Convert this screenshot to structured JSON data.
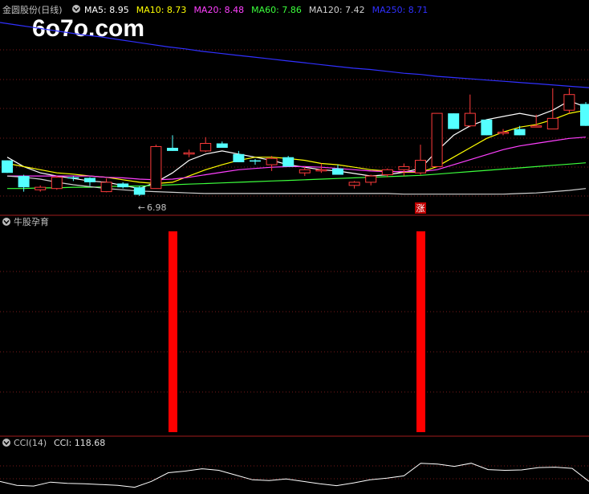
{
  "watermark": "6o7o.com",
  "colors": {
    "background": "#000000",
    "up": "#ff3b3b",
    "down": "#54ffff",
    "grid": "#7a1a1a",
    "divider": "#a01c1c",
    "signal_bar": "#ff0000",
    "cci_line": "#ffffff",
    "header_text": "#c0c0c0"
  },
  "chart_data": [
    {
      "type": "candlestick",
      "panel": "price",
      "title": "金圆股份(日线)",
      "ma_legend": [
        {
          "name": "MA5",
          "text": "MA5: 8.95",
          "color": "#ffffff"
        },
        {
          "name": "MA10",
          "text": "MA10: 8.73",
          "color": "#ffff00"
        },
        {
          "name": "MA20",
          "text": "MA20: 8.48",
          "color": "#ff40ff"
        },
        {
          "name": "MA60",
          "text": "MA60: 7.86",
          "color": "#3cff3c"
        },
        {
          "name": "MA120",
          "text": "MA120: 7.42",
          "color": "#d0d0d0"
        },
        {
          "name": "MA250",
          "text": "MA250: 8.71",
          "color": "#3030ff"
        }
      ],
      "ylim": [
        6.75,
        9.75
      ],
      "x": [
        0,
        1,
        2,
        3,
        4,
        5,
        6,
        7,
        8,
        9,
        10,
        11,
        12,
        13,
        14,
        15,
        16,
        17,
        18,
        19,
        20,
        21,
        22,
        23,
        24,
        25,
        26,
        27,
        28,
        29,
        30,
        31,
        32,
        33,
        34,
        35
      ],
      "ohlc": [
        [
          7.55,
          7.55,
          7.35,
          7.35
        ],
        [
          7.3,
          7.32,
          7.05,
          7.12
        ],
        [
          7.08,
          7.15,
          7.05,
          7.12
        ],
        [
          7.1,
          7.3,
          7.08,
          7.28
        ],
        [
          7.28,
          7.3,
          7.22,
          7.27
        ],
        [
          7.27,
          7.28,
          7.14,
          7.2
        ],
        [
          7.05,
          7.26,
          7.04,
          7.2
        ],
        [
          7.18,
          7.2,
          7.1,
          7.12
        ],
        [
          7.12,
          7.14,
          6.98,
          7.0
        ],
        [
          7.1,
          7.8,
          7.1,
          7.77
        ],
        [
          7.75,
          7.95,
          7.7,
          7.7
        ],
        [
          7.65,
          7.72,
          7.6,
          7.67
        ],
        [
          7.7,
          7.92,
          7.68,
          7.82
        ],
        [
          7.82,
          7.85,
          7.75,
          7.75
        ],
        [
          7.65,
          7.7,
          7.52,
          7.52
        ],
        [
          7.55,
          7.57,
          7.48,
          7.53
        ],
        [
          7.48,
          7.62,
          7.38,
          7.58
        ],
        [
          7.6,
          7.62,
          7.55,
          7.45
        ],
        [
          7.35,
          7.45,
          7.3,
          7.4
        ],
        [
          7.4,
          7.5,
          7.35,
          7.4
        ],
        [
          7.42,
          7.48,
          7.36,
          7.32
        ],
        [
          7.15,
          7.22,
          7.1,
          7.2
        ],
        [
          7.2,
          7.32,
          7.15,
          7.3
        ],
        [
          7.32,
          7.42,
          7.28,
          7.4
        ],
        [
          7.4,
          7.5,
          7.3,
          7.45
        ],
        [
          7.35,
          7.8,
          7.32,
          7.55
        ],
        [
          7.45,
          8.3,
          7.45,
          8.3
        ],
        [
          8.3,
          8.3,
          8.05,
          8.05
        ],
        [
          8.1,
          8.6,
          8.08,
          8.3
        ],
        [
          8.2,
          8.2,
          7.95,
          7.95
        ],
        [
          7.98,
          8.05,
          7.95,
          8.0
        ],
        [
          8.05,
          8.1,
          7.95,
          7.95
        ],
        [
          8.1,
          8.28,
          8.08,
          8.1
        ],
        [
          8.05,
          8.7,
          8.05,
          8.22
        ],
        [
          8.35,
          8.7,
          8.3,
          8.6
        ],
        [
          8.45,
          8.48,
          8.1,
          8.1
        ]
      ],
      "ma": {
        "MA5": [
          7.6,
          7.45,
          7.35,
          7.3,
          7.26,
          7.22,
          7.2,
          7.15,
          7.1,
          7.2,
          7.35,
          7.55,
          7.65,
          7.7,
          7.65,
          7.6,
          7.55,
          7.48,
          7.44,
          7.4,
          7.38,
          7.34,
          7.3,
          7.32,
          7.36,
          7.42,
          7.7,
          7.95,
          8.1,
          8.2,
          8.25,
          8.3,
          8.25,
          8.35,
          8.5,
          8.4
        ],
        "MA10": [
          7.5,
          7.45,
          7.4,
          7.35,
          7.33,
          7.3,
          7.28,
          7.24,
          7.2,
          7.18,
          7.2,
          7.3,
          7.4,
          7.48,
          7.55,
          7.6,
          7.6,
          7.58,
          7.55,
          7.5,
          7.48,
          7.44,
          7.4,
          7.38,
          7.36,
          7.36,
          7.45,
          7.6,
          7.75,
          7.9,
          8.0,
          8.08,
          8.12,
          8.2,
          8.3,
          8.35
        ],
        "MA20": [
          7.3,
          7.3,
          7.3,
          7.3,
          7.3,
          7.3,
          7.28,
          7.27,
          7.25,
          7.24,
          7.25,
          7.28,
          7.32,
          7.36,
          7.4,
          7.42,
          7.44,
          7.45,
          7.45,
          7.44,
          7.42,
          7.4,
          7.38,
          7.37,
          7.37,
          7.37,
          7.4,
          7.48,
          7.56,
          7.64,
          7.72,
          7.78,
          7.82,
          7.86,
          7.9,
          7.92
        ],
        "MA60": [
          7.1,
          7.1,
          7.11,
          7.11,
          7.12,
          7.12,
          7.13,
          7.14,
          7.14,
          7.15,
          7.16,
          7.17,
          7.18,
          7.19,
          7.2,
          7.21,
          7.22,
          7.23,
          7.24,
          7.25,
          7.26,
          7.27,
          7.28,
          7.29,
          7.3,
          7.31,
          7.33,
          7.35,
          7.37,
          7.39,
          7.41,
          7.43,
          7.45,
          7.47,
          7.49,
          7.51
        ],
        "MA120": [
          7.3,
          7.28,
          7.25,
          7.2,
          7.16,
          7.13,
          7.1,
          7.08,
          7.06,
          7.05,
          7.04,
          7.03,
          7.02,
          7.02,
          7.02,
          7.02,
          7.02,
          7.02,
          7.02,
          7.02,
          7.02,
          7.02,
          7.02,
          7.02,
          7.01,
          7.01,
          7.01,
          7.01,
          7.01,
          7.01,
          7.01,
          7.02,
          7.03,
          7.05,
          7.07,
          7.1
        ],
        "MA250": [
          9.75,
          9.71,
          9.67,
          9.63,
          9.59,
          9.55,
          9.52,
          9.48,
          9.44,
          9.4,
          9.36,
          9.33,
          9.29,
          9.26,
          9.23,
          9.2,
          9.17,
          9.14,
          9.11,
          9.08,
          9.05,
          9.02,
          9.0,
          8.97,
          8.94,
          8.92,
          8.89,
          8.87,
          8.85,
          8.83,
          8.81,
          8.79,
          8.77,
          8.75,
          8.73,
          8.71
        ]
      },
      "annotations": [
        {
          "index": 8,
          "text": "6.98",
          "prefix": "←"
        },
        {
          "index": 25,
          "text": "涨"
        }
      ]
    },
    {
      "type": "bar",
      "panel": "indicator",
      "title": "牛股孕育",
      "signal_indices": [
        10,
        25
      ]
    },
    {
      "type": "line",
      "panel": "cci",
      "title": "CCI(14)",
      "value_text": "CCI: 118.68",
      "ylim": [
        -250,
        250
      ],
      "values": [
        -120,
        -170,
        -180,
        -130,
        -145,
        -150,
        -160,
        -170,
        -195,
        -120,
        -10,
        10,
        40,
        20,
        -40,
        -100,
        -110,
        -90,
        -120,
        -150,
        -175,
        -140,
        -100,
        -80,
        -50,
        110,
        100,
        70,
        110,
        30,
        20,
        25,
        55,
        60,
        45,
        -120
      ]
    }
  ]
}
